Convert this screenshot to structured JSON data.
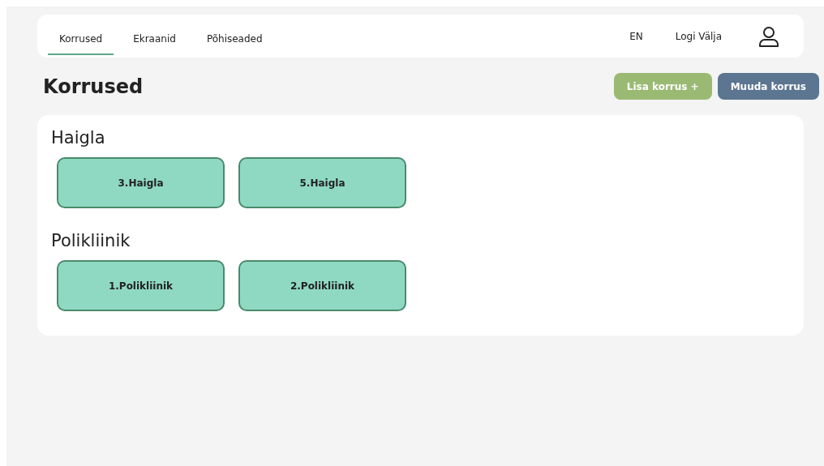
{
  "nav": {
    "tabs": [
      {
        "label": "Korrused",
        "selected": true
      },
      {
        "label": "Ekraanid",
        "selected": false
      },
      {
        "label": "Põhiseaded",
        "selected": false
      }
    ],
    "language": "EN",
    "logout": "Logi Välja"
  },
  "page": {
    "title": "Korrused",
    "buttons": [
      {
        "label": "Lisa korrus +",
        "kind": "add"
      },
      {
        "label": "Muuda korrus",
        "kind": "edit"
      }
    ]
  },
  "groups": [
    {
      "title": "Haigla",
      "floors": [
        "3.Haigla",
        "5.Haigla"
      ]
    },
    {
      "title": "Polikliinik",
      "floors": [
        "1.Polikliinik",
        "2.Polikliinik"
      ]
    }
  ]
}
